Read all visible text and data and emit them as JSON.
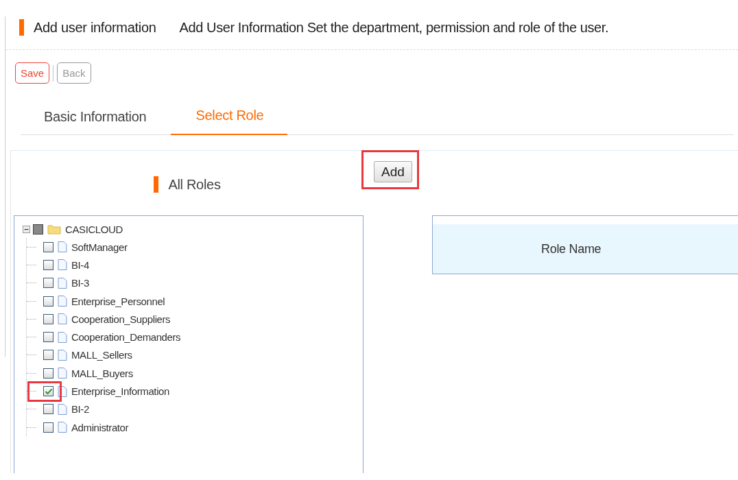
{
  "header": {
    "title": "Add user information",
    "description": "Add User Information Set the department, permission and role of the user."
  },
  "toolbar": [
    {
      "label": "Save",
      "kind": "primary"
    },
    {
      "label": "Back",
      "kind": "secondary"
    }
  ],
  "tabs": [
    {
      "label": "Basic Information",
      "selected": false
    },
    {
      "label": "Select Role",
      "selected": true
    }
  ],
  "all_roles": {
    "title": "All Roles"
  },
  "add_button": {
    "label": "Add",
    "highlighted": true
  },
  "tree": {
    "label": "CASICLOUD",
    "expanded": true,
    "indeterminate": true,
    "children": [
      {
        "label": "SoftManager",
        "checked": false,
        "highlighted": false
      },
      {
        "label": "BI-4",
        "checked": false,
        "highlighted": false
      },
      {
        "label": "BI-3",
        "checked": false,
        "highlighted": false
      },
      {
        "label": "Enterprise_Personnel",
        "checked": false,
        "highlighted": false
      },
      {
        "label": "Cooperation_Suppliers",
        "checked": false,
        "highlighted": false
      },
      {
        "label": "Cooperation_Demanders",
        "checked": false,
        "highlighted": false
      },
      {
        "label": "MALL_Sellers",
        "checked": false,
        "highlighted": false
      },
      {
        "label": "MALL_Buyers",
        "checked": false,
        "highlighted": false
      },
      {
        "label": "Enterprise_Information",
        "checked": true,
        "highlighted": true
      },
      {
        "label": "BI-2",
        "checked": false,
        "highlighted": false
      },
      {
        "label": "Administrator",
        "checked": false,
        "highlighted": false
      }
    ]
  },
  "selected_table": {
    "columns": [
      "Role Name"
    ]
  }
}
